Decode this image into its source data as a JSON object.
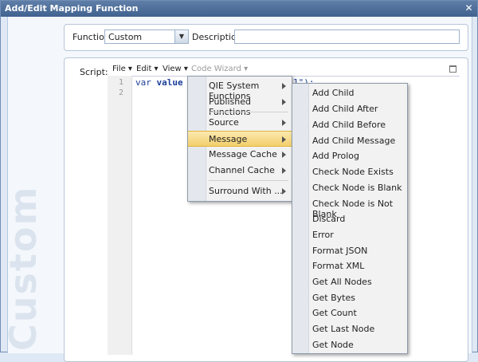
{
  "window": {
    "title": "Add/Edit Mapping Function"
  },
  "watermark": "Custom",
  "form": {
    "function_label": "Function:",
    "function_value": "Custom",
    "description_label": "Description:",
    "description_value": "",
    "script_label": "Script:"
  },
  "editor_menu": {
    "file": "File",
    "edit": "Edit",
    "view": "View",
    "code_wizard": "Code Wizard"
  },
  "editor": {
    "line_numbers": [
      "1",
      "2"
    ],
    "code_kw": "var",
    "code_ident": "value",
    "code_tail": "1\");"
  },
  "code_wizard_menu": {
    "items": [
      {
        "label": "QIE System Functions",
        "submenu": true
      },
      {
        "label": "Published Functions",
        "submenu": true
      },
      {
        "label": "Source",
        "submenu": true
      },
      {
        "label": "Message",
        "submenu": true,
        "active": true
      },
      {
        "label": "Message Cache",
        "submenu": true
      },
      {
        "label": "Channel Cache",
        "submenu": true
      },
      {
        "label": "Surround With ...",
        "submenu": true
      }
    ]
  },
  "message_submenu": {
    "items": [
      "Add Child",
      "Add Child After",
      "Add Child Before",
      "Add Child Message",
      "Add Prolog",
      "Check Node Exists",
      "Check Node is Blank",
      "Check Node is Not Blank",
      "Discard",
      "Error",
      "Format JSON",
      "Format XML",
      "Get All Nodes",
      "Get Bytes",
      "Get Count",
      "Get Last Node",
      "Get Node"
    ]
  },
  "colors": {
    "title_bar": "#4a6b97",
    "highlight": "#f3cf6c",
    "code_text": "#1c3f9a"
  }
}
